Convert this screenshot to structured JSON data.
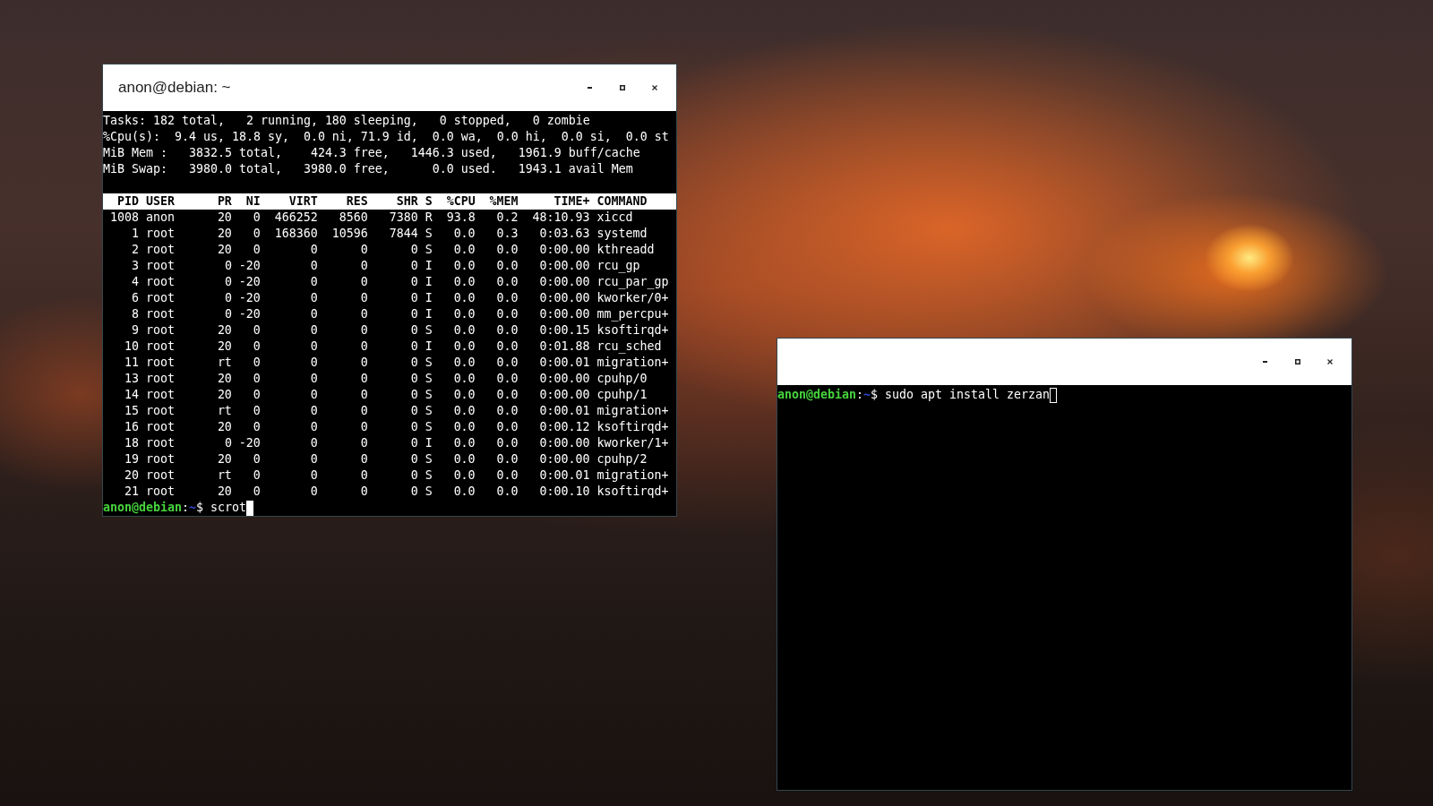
{
  "windows": [
    {
      "title": "anon@debian: ~",
      "focused": true,
      "summary": [
        "Tasks: 182 total,   2 running, 180 sleeping,   0 stopped,   0 zombie",
        "%Cpu(s):  9.4 us, 18.8 sy,  0.0 ni, 71.9 id,  0.0 wa,  0.0 hi,  0.0 si,  0.0 st",
        "MiB Mem :   3832.5 total,    424.3 free,   1446.3 used,   1961.9 buff/cache",
        "MiB Swap:   3980.0 total,   3980.0 free,      0.0 used.   1943.1 avail Mem"
      ],
      "table": {
        "columns": [
          "PID",
          "USER",
          "PR",
          "NI",
          "VIRT",
          "RES",
          "SHR",
          "S",
          "%CPU",
          "%MEM",
          "TIME+",
          "COMMAND"
        ],
        "rows": [
          [
            "1008",
            "anon",
            "20",
            "0",
            "466252",
            "8560",
            "7380",
            "R",
            "93.8",
            "0.2",
            "48:10.93",
            "xiccd"
          ],
          [
            "1",
            "root",
            "20",
            "0",
            "168360",
            "10596",
            "7844",
            "S",
            "0.0",
            "0.3",
            "0:03.63",
            "systemd"
          ],
          [
            "2",
            "root",
            "20",
            "0",
            "0",
            "0",
            "0",
            "S",
            "0.0",
            "0.0",
            "0:00.00",
            "kthreadd"
          ],
          [
            "3",
            "root",
            "0",
            "-20",
            "0",
            "0",
            "0",
            "I",
            "0.0",
            "0.0",
            "0:00.00",
            "rcu_gp"
          ],
          [
            "4",
            "root",
            "0",
            "-20",
            "0",
            "0",
            "0",
            "I",
            "0.0",
            "0.0",
            "0:00.00",
            "rcu_par_gp"
          ],
          [
            "6",
            "root",
            "0",
            "-20",
            "0",
            "0",
            "0",
            "I",
            "0.0",
            "0.0",
            "0:00.00",
            "kworker/0+"
          ],
          [
            "8",
            "root",
            "0",
            "-20",
            "0",
            "0",
            "0",
            "I",
            "0.0",
            "0.0",
            "0:00.00",
            "mm_percpu+"
          ],
          [
            "9",
            "root",
            "20",
            "0",
            "0",
            "0",
            "0",
            "S",
            "0.0",
            "0.0",
            "0:00.15",
            "ksoftirqd+"
          ],
          [
            "10",
            "root",
            "20",
            "0",
            "0",
            "0",
            "0",
            "I",
            "0.0",
            "0.0",
            "0:01.88",
            "rcu_sched"
          ],
          [
            "11",
            "root",
            "rt",
            "0",
            "0",
            "0",
            "0",
            "S",
            "0.0",
            "0.0",
            "0:00.01",
            "migration+"
          ],
          [
            "13",
            "root",
            "20",
            "0",
            "0",
            "0",
            "0",
            "S",
            "0.0",
            "0.0",
            "0:00.00",
            "cpuhp/0"
          ],
          [
            "14",
            "root",
            "20",
            "0",
            "0",
            "0",
            "0",
            "S",
            "0.0",
            "0.0",
            "0:00.00",
            "cpuhp/1"
          ],
          [
            "15",
            "root",
            "rt",
            "0",
            "0",
            "0",
            "0",
            "S",
            "0.0",
            "0.0",
            "0:00.01",
            "migration+"
          ],
          [
            "16",
            "root",
            "20",
            "0",
            "0",
            "0",
            "0",
            "S",
            "0.0",
            "0.0",
            "0:00.12",
            "ksoftirqd+"
          ],
          [
            "18",
            "root",
            "0",
            "-20",
            "0",
            "0",
            "0",
            "I",
            "0.0",
            "0.0",
            "0:00.00",
            "kworker/1+"
          ],
          [
            "19",
            "root",
            "20",
            "0",
            "0",
            "0",
            "0",
            "S",
            "0.0",
            "0.0",
            "0:00.00",
            "cpuhp/2"
          ],
          [
            "20",
            "root",
            "rt",
            "0",
            "0",
            "0",
            "0",
            "S",
            "0.0",
            "0.0",
            "0:00.01",
            "migration+"
          ],
          [
            "21",
            "root",
            "20",
            "0",
            "0",
            "0",
            "0",
            "S",
            "0.0",
            "0.0",
            "0:00.10",
            "ksoftirqd+"
          ]
        ]
      },
      "prompt": [
        {
          "kind": "user_host",
          "text": "anon@debian"
        },
        {
          "kind": "plain",
          "text": ":"
        },
        {
          "kind": "path",
          "text": "~"
        },
        {
          "kind": "plain",
          "text": "$"
        }
      ],
      "command": "scrot"
    },
    {
      "focused": false,
      "prompt": [
        {
          "kind": "user_host",
          "text": "anon@debian"
        },
        {
          "kind": "plain",
          "text": ":"
        },
        {
          "kind": "path",
          "text": "~"
        },
        {
          "kind": "plain",
          "text": "$"
        }
      ],
      "command": "sudo apt install zerzan"
    }
  ]
}
